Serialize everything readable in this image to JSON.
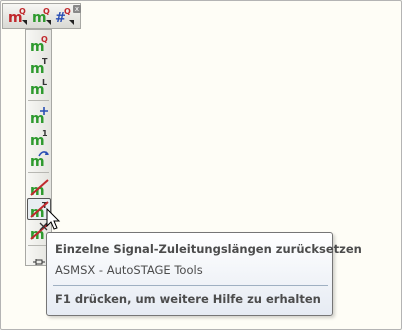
{
  "top_toolbar": {
    "close_glyph": "x",
    "buttons": [
      {
        "icon": "m-q-dropdown-icon"
      },
      {
        "icon": "m-q-dropdown-icon"
      },
      {
        "icon": "hash-q-dropdown-icon"
      }
    ]
  },
  "side_toolbar": {
    "buttons": [
      {
        "icon": "m-q-icon"
      },
      {
        "icon": "m-t-icon"
      },
      {
        "icon": "m-l-icon"
      },
      {
        "icon": "m-plus-icon"
      },
      {
        "icon": "m-1-icon"
      },
      {
        "icon": "m-arrow-icon"
      },
      {
        "icon": "strike-icon"
      },
      {
        "icon": "strike-t-icon",
        "active": true
      },
      {
        "icon": "strike-x-icon"
      }
    ],
    "pin_icon": "pin-icon"
  },
  "tooltip": {
    "title": "Einzelne Signal-Zuleitungslängen zurücksetzen",
    "body": "ASMSX - AutoSTAGE Tools",
    "help": "F1 drücken, um weitere Hilfe zu erhalten"
  },
  "colors": {
    "green": "#2e9a2e",
    "red": "#c0282c",
    "blue": "#2a4fb4",
    "background": "#fefdf6"
  }
}
